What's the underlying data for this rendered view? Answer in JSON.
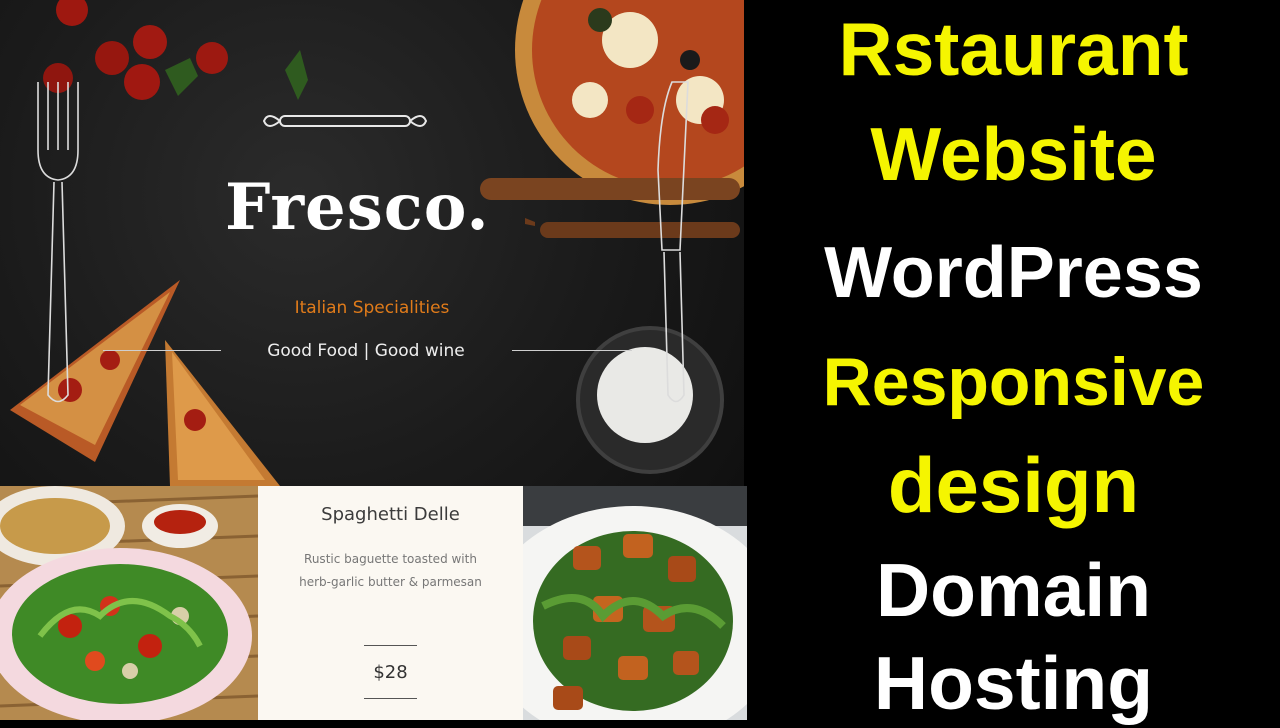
{
  "hero": {
    "brand": "Fresco.",
    "subtitle": "Italian Specialities",
    "tagline": "Good Food | Good wine"
  },
  "menu_card": {
    "title": "Spaghetti Delle",
    "description": "Rustic baguette toasted with herb-garlic butter & parmesan",
    "price": "$28"
  },
  "caption": {
    "lines": [
      "Rstaurant",
      "Website",
      "WordPress",
      "Responsive",
      "design",
      "Domain",
      "Hosting"
    ],
    "line_colors": [
      "#f5f500",
      "#f5f500",
      "#ffffff",
      "#f5f500",
      "#f5f500",
      "#ffffff",
      "#ffffff"
    ]
  },
  "icons": [
    "fork-icon",
    "knife-icon",
    "ornament-icon"
  ],
  "colors": {
    "accent": "#e07b1a",
    "caption_yellow": "#f5f500",
    "background": "#000000"
  }
}
